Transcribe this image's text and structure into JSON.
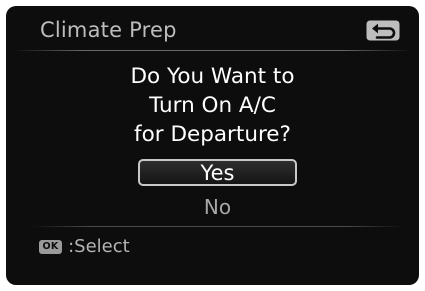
{
  "header": {
    "title": "Climate Prep",
    "back_icon": "return-arrow-icon"
  },
  "dialog": {
    "question_lines": [
      "Do You Want to",
      "Turn On A/C",
      "for Departure?"
    ],
    "options": [
      {
        "label": "Yes",
        "selected": true
      },
      {
        "label": "No",
        "selected": false
      }
    ]
  },
  "footer": {
    "button_badge": "OK",
    "hint": ":Select"
  },
  "colors": {
    "background": "#0d0d0d",
    "title_text": "#bdbdbd",
    "question_text": "#ffffff",
    "selected_border": "#c8c8c8",
    "unselected_text": "#a7a7a7",
    "hint_text": "#b4b4b4"
  }
}
